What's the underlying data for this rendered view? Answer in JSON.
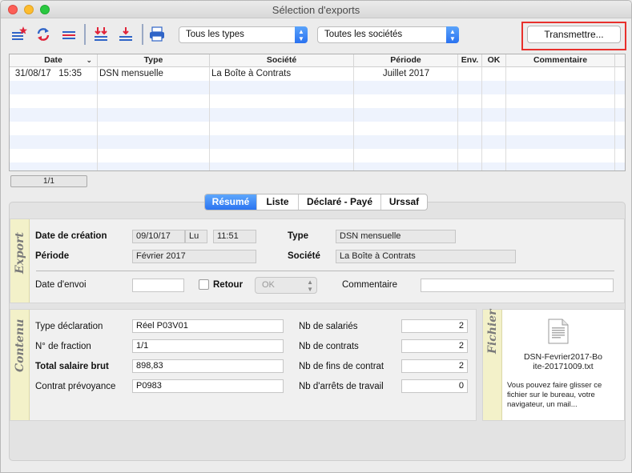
{
  "window": {
    "title": "Sélection d'exports"
  },
  "toolbar": {
    "type_filter": "Tous les types",
    "company_filter": "Toutes les sociétés",
    "transmit_label": "Transmettre..."
  },
  "table": {
    "headers": {
      "date": "Date",
      "type": "Type",
      "societe": "Société",
      "periode": "Période",
      "env": "Env.",
      "ok": "OK",
      "commentaire": "Commentaire"
    },
    "rows": [
      {
        "date": "31/08/17",
        "time": "15:35",
        "type": "DSN mensuelle",
        "societe": "La Boîte à Contrats",
        "periode": "Juillet 2017",
        "env": "",
        "ok": "",
        "commentaire": ""
      }
    ],
    "pager": "1/1"
  },
  "tabs": [
    "Résumé",
    "Liste",
    "Déclaré - Payé",
    "Urssaf"
  ],
  "export": {
    "section_title": "Export",
    "date_creation_label": "Date de création",
    "date_creation": "09/10/17",
    "day": "Lu",
    "time": "11:51",
    "type_label": "Type",
    "type": "DSN mensuelle",
    "periode_label": "Période",
    "periode": "Février 2017",
    "societe_label": "Société",
    "societe": "La Boîte à Contrats",
    "date_envoi_label": "Date d'envoi",
    "date_envoi": "",
    "retour_label": "Retour",
    "retour_value": "OK",
    "commentaire_label": "Commentaire",
    "commentaire": ""
  },
  "contenu": {
    "section_title": "Contenu",
    "type_decl_label": "Type déclaration",
    "type_decl": "Réel P03V01",
    "fraction_label": "N° de fraction",
    "fraction": "1/1",
    "salaire_label": "Total salaire brut",
    "salaire": "898,83",
    "prevoyance_label": "Contrat prévoyance",
    "prevoyance": "P0983",
    "nb_salaries_label": "Nb de salariés",
    "nb_salaries": "2",
    "nb_contrats_label": "Nb de contrats",
    "nb_contrats": "2",
    "nb_fins_label": "Nb de fins de contrat",
    "nb_fins": "2",
    "nb_arrets_label": "Nb d'arrêts de travail",
    "nb_arrets": "0"
  },
  "fichier": {
    "section_title": "Fichier",
    "filename": "DSN-Fevrier2017-Boite-20171009.txt",
    "hint": "Vous pouvez faire glisser ce fichier sur le bureau, votre navigateur, un mail..."
  },
  "colors": {
    "accent": "#2b74f1",
    "highlight": "#e8302c",
    "section_bg": "#f3f1c9"
  }
}
